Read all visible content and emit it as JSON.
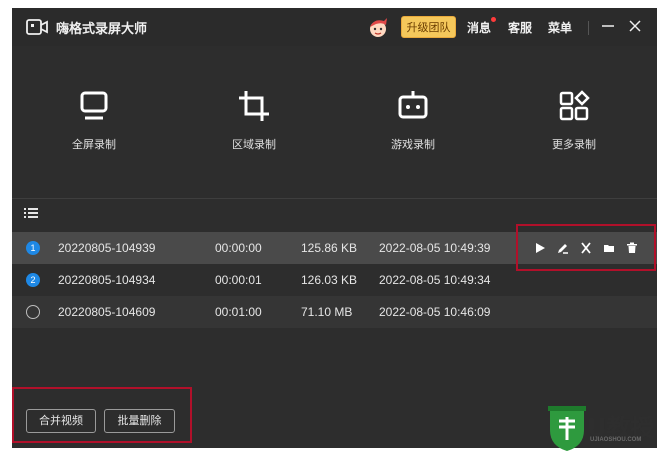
{
  "app": {
    "title": "嗨格式录屏大师",
    "upgrade_label": "升级团队",
    "messages_label": "消息",
    "support_label": "客服",
    "menu_label": "菜单"
  },
  "modes": [
    {
      "label": "全屏录制",
      "icon": "monitor-icon"
    },
    {
      "label": "区域录制",
      "icon": "crop-icon"
    },
    {
      "label": "游戏录制",
      "icon": "gamepad-icon"
    },
    {
      "label": "更多录制",
      "icon": "grid-icon"
    }
  ],
  "recordings": [
    {
      "index": "1",
      "name": "20220805-104939",
      "duration": "00:00:00",
      "size": "125.86 KB",
      "date": "2022-08-05 10:49:39",
      "state": "selected"
    },
    {
      "index": "2",
      "name": "20220805-104934",
      "duration": "00:00:01",
      "size": "126.03 KB",
      "date": "2022-08-05 10:49:34",
      "state": "checked"
    },
    {
      "index": "",
      "name": "20220805-104609",
      "duration": "00:01:00",
      "size": "71.10 MB",
      "date": "2022-08-05 10:46:09",
      "state": "unchecked"
    }
  ],
  "row_actions": [
    "play-icon",
    "edit-icon",
    "cut-icon",
    "folder-icon",
    "delete-icon"
  ],
  "footer": {
    "merge_label": "合并视频",
    "batch_delete_label": "批量删除"
  },
  "watermark": {
    "brand": "U教授",
    "site": "UJIAOSHOU.COM"
  },
  "colors": {
    "background": "#2d2d2d",
    "selected_row": "#4a4a4a",
    "accent": "#1e88e5",
    "upgrade": "#f5c85b",
    "highlight_box": "#b1102a"
  }
}
